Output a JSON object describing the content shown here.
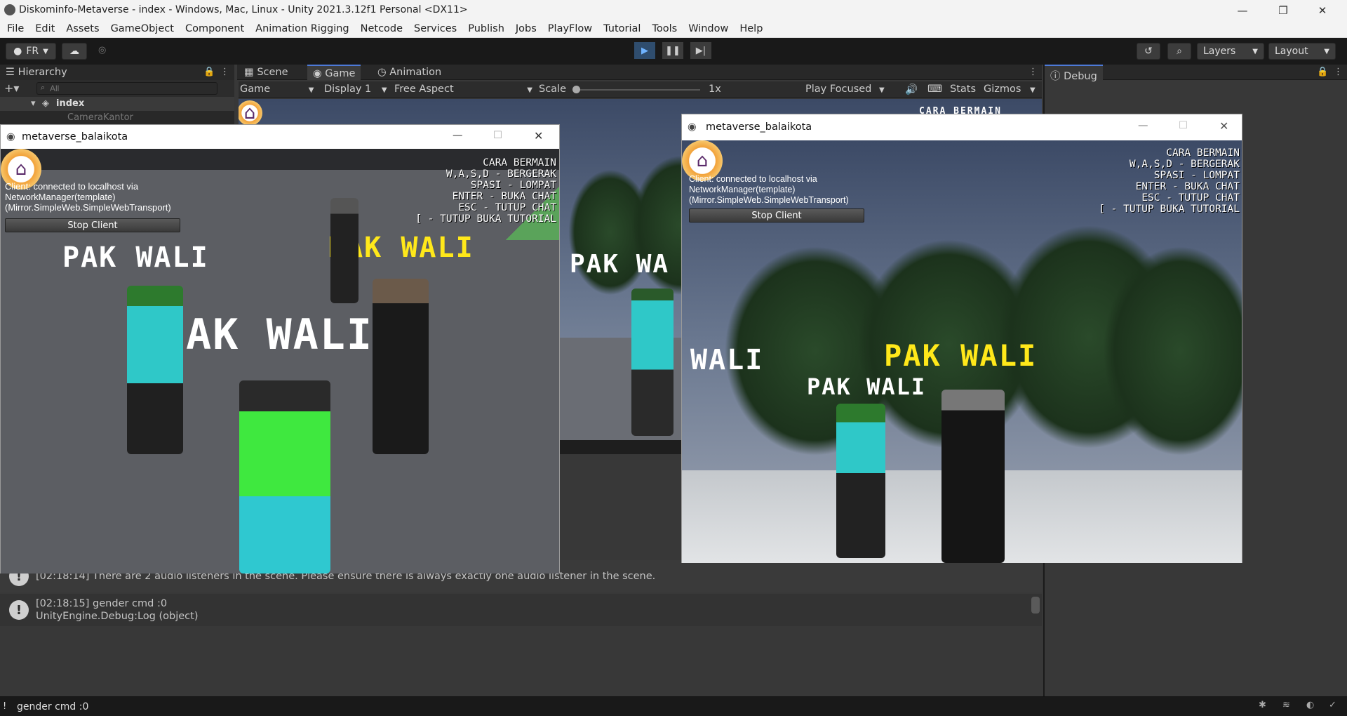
{
  "window": {
    "title": "Diskominfo-Metaverse - index - Windows, Mac, Linux - Unity 2021.3.12f1 Personal <DX11>",
    "controls": {
      "minimize": "—",
      "restore": "❐",
      "close": "✕"
    }
  },
  "menu": [
    "File",
    "Edit",
    "Assets",
    "GameObject",
    "Component",
    "Animation Rigging",
    "Netcode",
    "Services",
    "Publish",
    "Jobs",
    "PlayFlow",
    "Tutorial",
    "Tools",
    "Window",
    "Help"
  ],
  "toolbar": {
    "account": "FR",
    "layers_label": "Layers",
    "layout_label": "Layout"
  },
  "hierarchy": {
    "tab": "Hierarchy",
    "search_placeholder": "All",
    "scene": "index",
    "child": "CameraKantor"
  },
  "center_tabs": [
    "Scene",
    "Game",
    "Animation"
  ],
  "debug_tab": "Debug",
  "gamebar": {
    "mode": "Game",
    "display": "Display 1",
    "aspect": "Free Aspect",
    "scale_label": "Scale",
    "scale_value": "1x",
    "play_focused": "Play Focused",
    "stats": "Stats",
    "gizmos": "Gizmos"
  },
  "game_window_left": {
    "title": "metaverse_balaikota",
    "net_status": "Client: connected to localhost via NetworkManager(template) (Mirror.SimpleWeb.SimpleWebTransport)",
    "net_lines": [
      "Client: connected to localhost via",
      "NetworkManager(template)",
      "(Mirror.SimpleWeb.SimpleWebTransport)"
    ],
    "stop_button": "Stop Client",
    "help_lines": [
      "CARA BERMAIN",
      "W,A,S,D - BERGERAK",
      "SPASI - LOMPAT",
      "ENTER - BUKA CHAT",
      "ESC - TUTUP CHAT",
      "[ - TUTUP BUKA TUTORIAL"
    ],
    "labels": [
      "PAK WALI",
      "PAK WALI",
      "PAK WALI"
    ]
  },
  "game_window_right": {
    "title": "metaverse_balaikota",
    "net_lines": [
      "Client: connected to localhost via",
      "NetworkManager(template)",
      "(Mirror.SimpleWeb.SimpleWebTransport)"
    ],
    "stop_button": "Stop Client",
    "help_lines": [
      "CARA BERMAIN",
      "W,A,S,D - BERGERAK",
      "SPASI - LOMPAT",
      "ENTER - BUKA CHAT",
      "ESC - TUTUP CHAT",
      "[ - TUTUP BUKA TUTORIAL"
    ],
    "labels": [
      "WALI",
      "PAK WALI",
      "PAK WALI"
    ]
  },
  "background_game": {
    "labels": [
      "CARA BERMAIN",
      "PAK WA"
    ]
  },
  "console": {
    "rows": [
      {
        "line1": "[02:18:14] There are 2 audio listeners in the scene. Please ensure there is always exactly one audio listener in the scene.",
        "line2": ""
      },
      {
        "line1": "[02:18:15] gender cmd :0",
        "line2": "UnityEngine.Debug:Log (object)"
      }
    ]
  },
  "statusbar": {
    "message": "gender cmd :0"
  },
  "colors": {
    "accent": "#4d7ad8",
    "yellow_label": "#ffe81a",
    "white_label": "#ffffff"
  }
}
